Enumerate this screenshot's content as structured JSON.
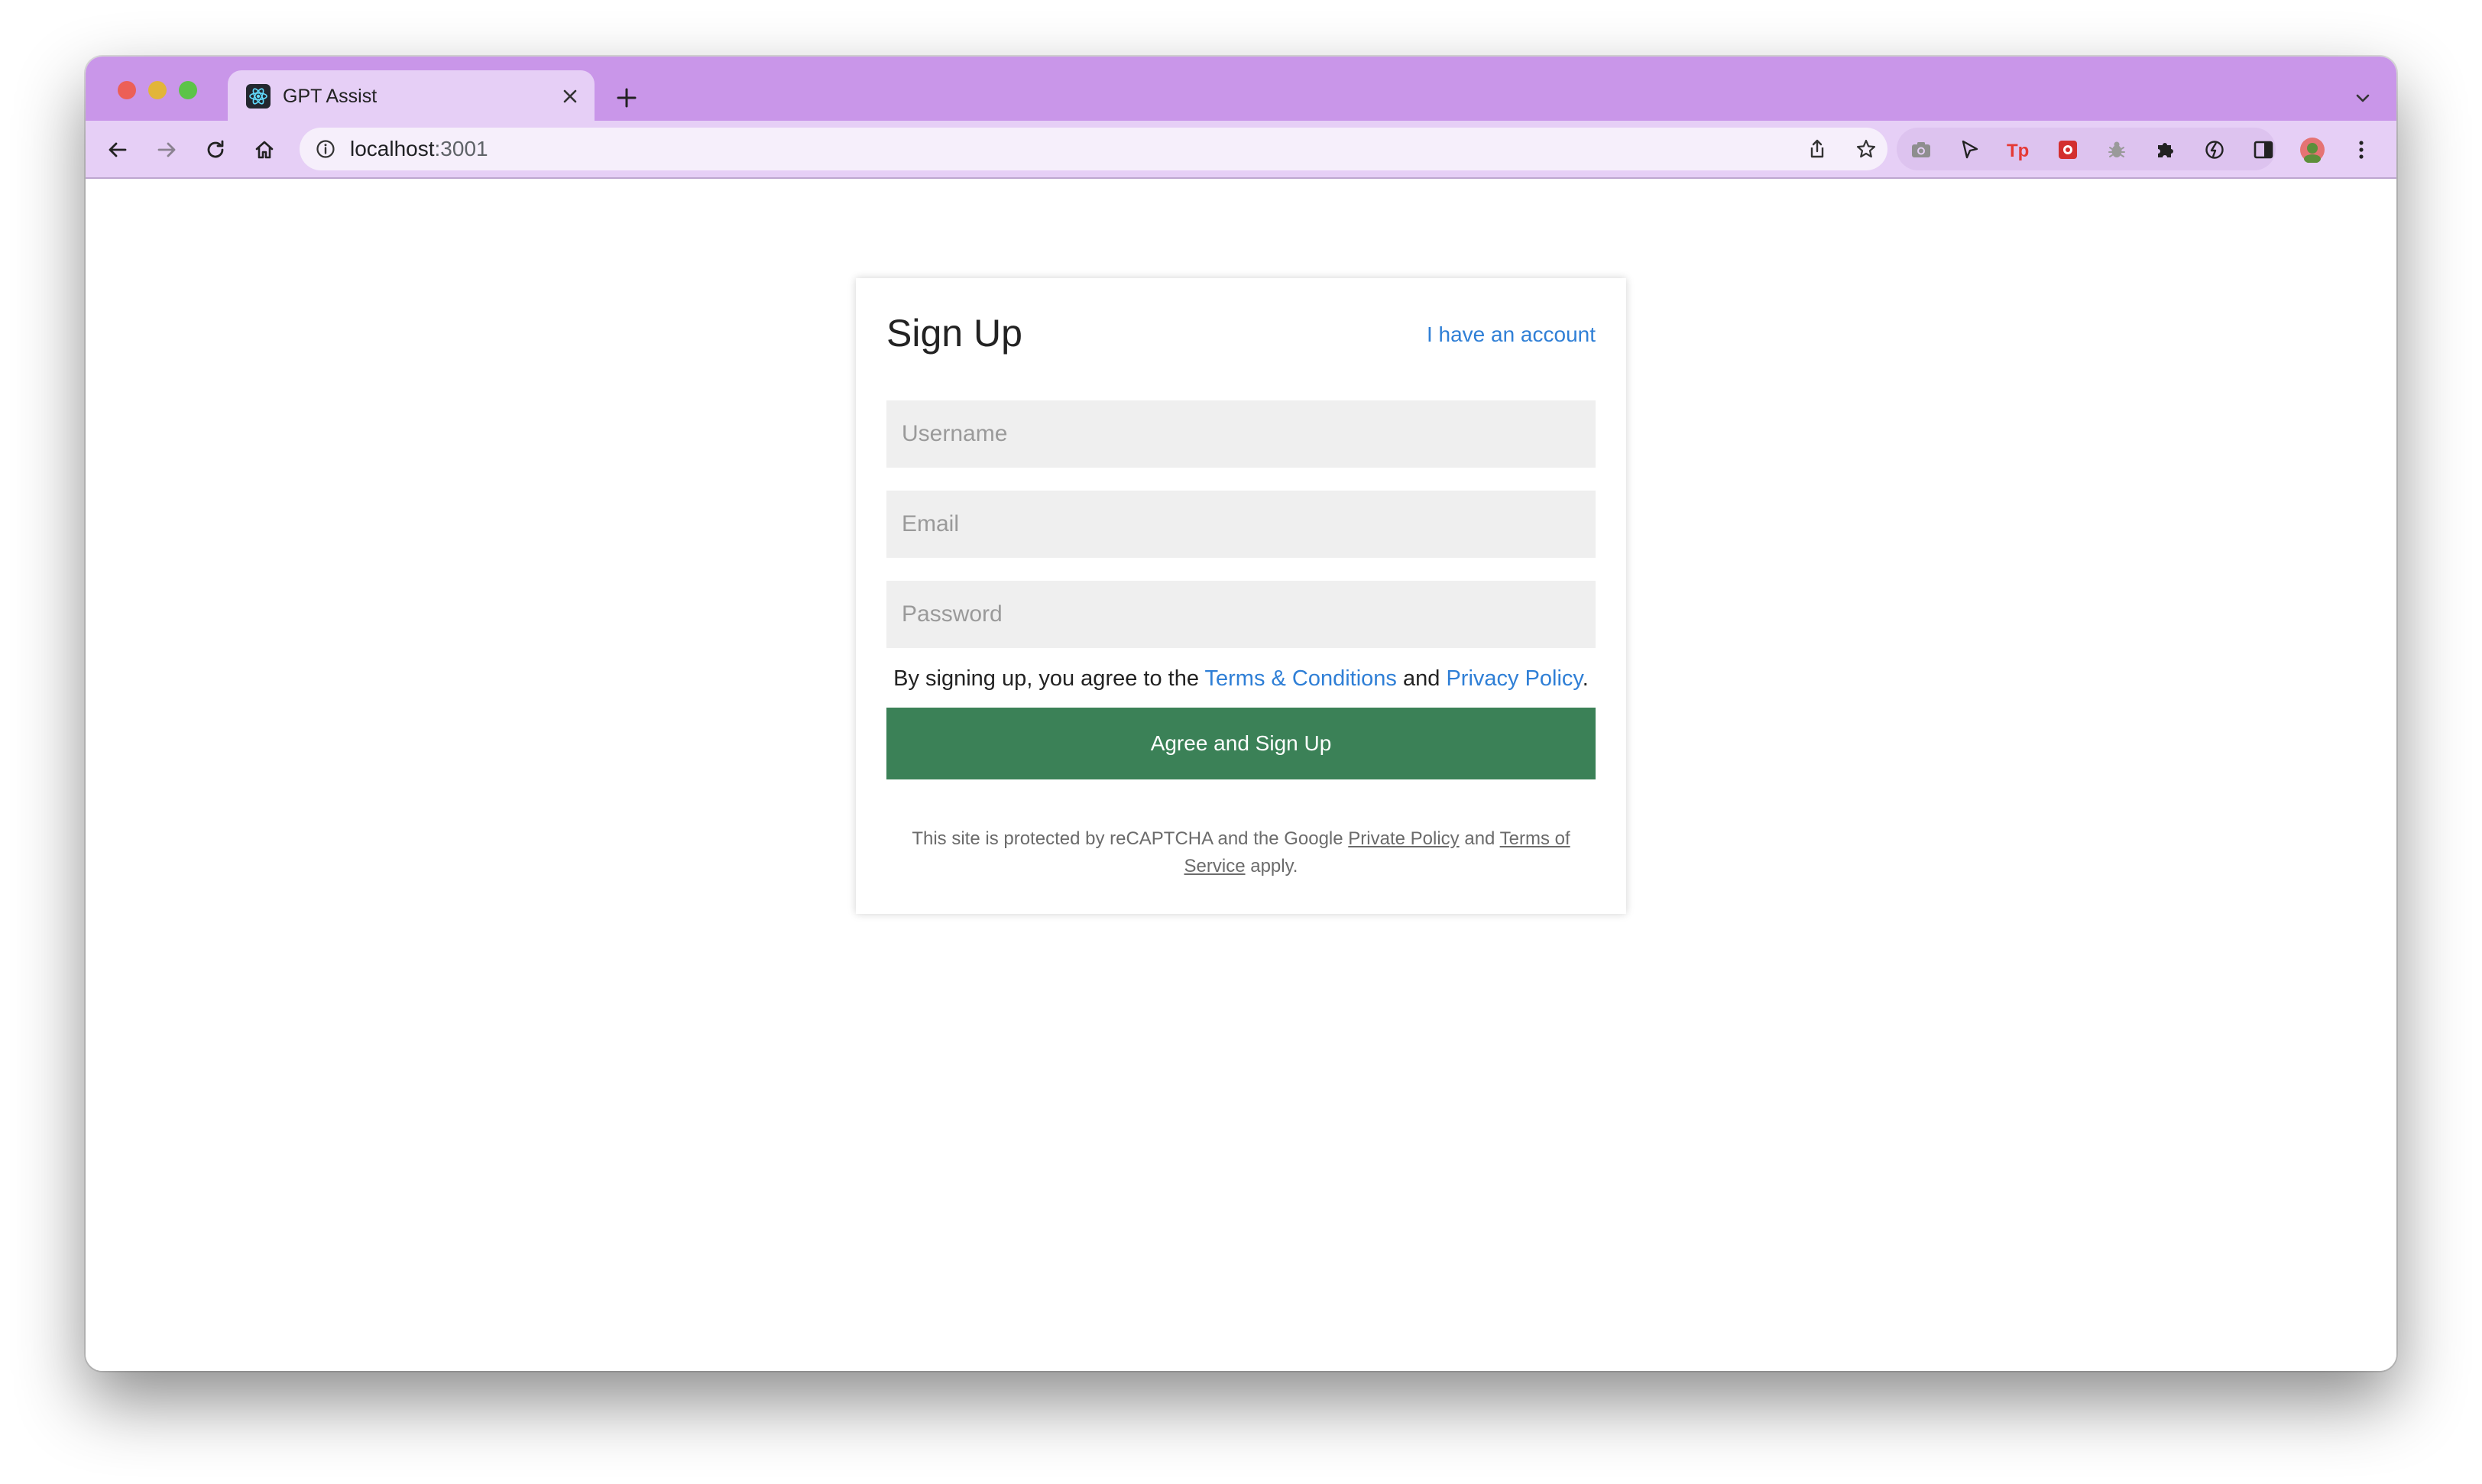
{
  "browser": {
    "tab": {
      "title": "GPT Assist",
      "favicon": "react-icon"
    },
    "address_bar": {
      "host": "localhost",
      "port": ":3001"
    },
    "theme_color": "#c996e9",
    "toolbar_color": "#e6cff6"
  },
  "signup": {
    "title": "Sign Up",
    "login_link": "I have an account",
    "fields": {
      "username_placeholder": "Username",
      "email_placeholder": "Email",
      "password_placeholder": "Password"
    },
    "terms": {
      "prefix": "By signing up, you agree to the ",
      "terms_link": "Terms & Conditions",
      "middle": " and ",
      "privacy_link": "Privacy Policy",
      "suffix": "."
    },
    "submit_label": "Agree and Sign Up",
    "recaptcha": {
      "prefix": "This site is protected by reCAPTCHA and the Google ",
      "privacy_link": "Private Policy",
      "middle": " and ",
      "terms_link": "Terms of Service",
      "suffix": " apply."
    },
    "colors": {
      "link": "#2f7fd6",
      "button": "#3b8157",
      "field_bg": "#efefef"
    }
  }
}
